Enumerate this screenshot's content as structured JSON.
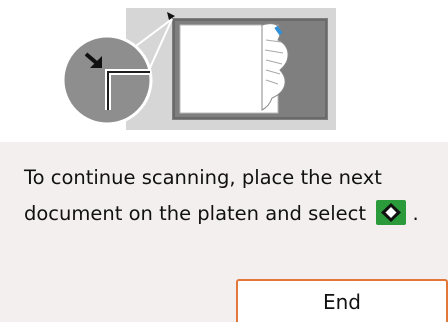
{
  "message": {
    "text_before_icon": "To continue scanning, place the next document on the platen and select",
    "text_after_icon": " .",
    "icon": "start-color-scan-icon"
  },
  "end_button": {
    "label": "End"
  },
  "illustration": {
    "icons": [
      "zoom-bubble-icon",
      "arrow-corner-icon",
      "platen-glass-icon",
      "document-page-icon"
    ]
  },
  "colors": {
    "panel_background": "#f3efee",
    "button_border": "#e3773a",
    "start_icon_green": "#2a9a3a",
    "platen_gray": "#8e8e8e",
    "scanner_body": "#d6d6d6"
  }
}
